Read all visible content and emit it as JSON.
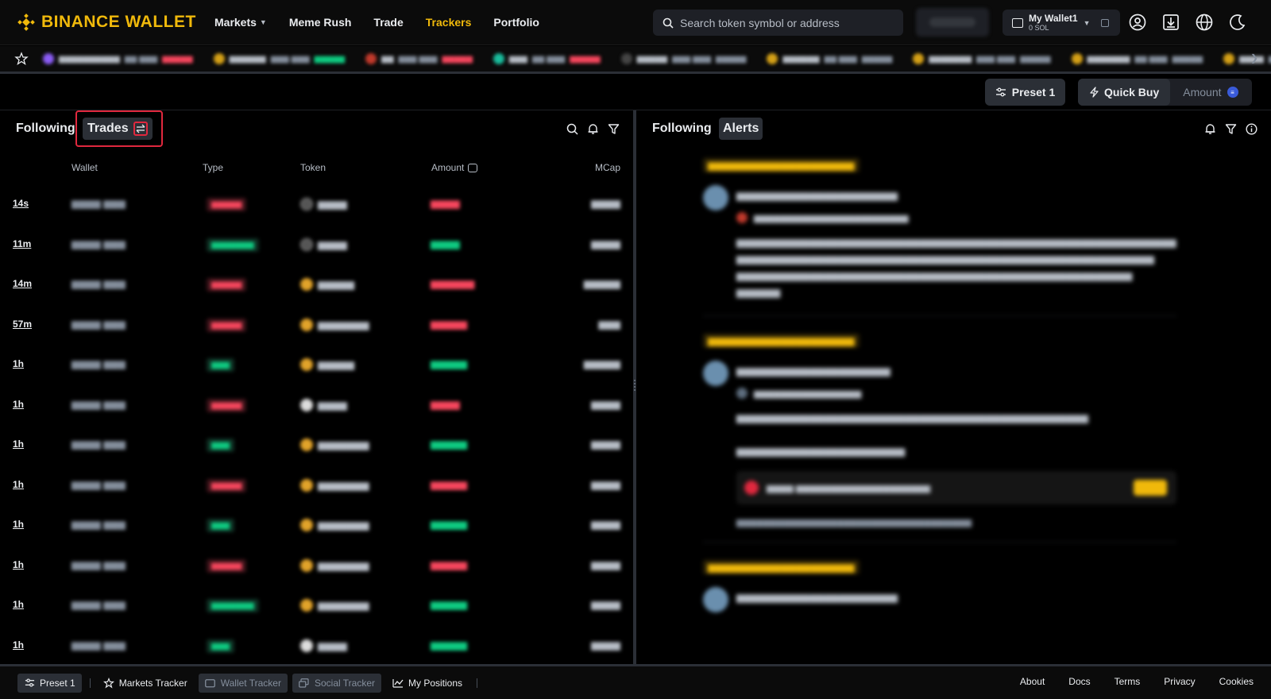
{
  "brand": {
    "name": "BINANCE WALLET",
    "color": "#f0b90b"
  },
  "nav": {
    "items": [
      {
        "label": "Markets",
        "has_dropdown": true,
        "active": false
      },
      {
        "label": "Meme Rush",
        "has_dropdown": false,
        "active": false
      },
      {
        "label": "Trade",
        "has_dropdown": false,
        "active": false
      },
      {
        "label": "Trackers",
        "has_dropdown": false,
        "active": true
      },
      {
        "label": "Portfolio",
        "has_dropdown": false,
        "active": false
      }
    ]
  },
  "search": {
    "placeholder": "Search token symbol or address",
    "icon": "search-icon"
  },
  "wallet": {
    "name": "My Wallet1",
    "balance": "0 SOL"
  },
  "top_icons": [
    "account-icon",
    "download-icon",
    "globe-icon",
    "moon-icon"
  ],
  "toolbar": {
    "preset_label": "Preset 1",
    "quick_buy_label": "Quick Buy",
    "amount_label": "Amount"
  },
  "left_panel": {
    "following_label": "Following",
    "trades_tab": "Trades",
    "columns": {
      "wallet": "Wallet",
      "type": "Type",
      "token": "Token",
      "amount": "Amount",
      "mcap": "MCap"
    },
    "rows": [
      {
        "age": "14s"
      },
      {
        "age": "11m"
      },
      {
        "age": "14m"
      },
      {
        "age": "57m"
      },
      {
        "age": "1h"
      },
      {
        "age": "1h"
      },
      {
        "age": "1h"
      },
      {
        "age": "1h"
      },
      {
        "age": "1h"
      },
      {
        "age": "1h"
      },
      {
        "age": "1h"
      },
      {
        "age": "1h"
      }
    ]
  },
  "right_panel": {
    "following_label": "Following",
    "alerts_tab": "Alerts"
  },
  "footer": {
    "preset_label": "Preset 1",
    "markets_tracker": "Markets Tracker",
    "wallet_tracker": "Wallet Tracker",
    "social_tracker": "Social Tracker",
    "my_positions": "My Positions",
    "links": [
      "About",
      "Docs",
      "Terms",
      "Privacy",
      "Cookies"
    ]
  },
  "colors": {
    "accent": "#f0b90b",
    "sell": "#f6465d",
    "buy": "#0ecb81",
    "highlight": "#e0283e"
  }
}
